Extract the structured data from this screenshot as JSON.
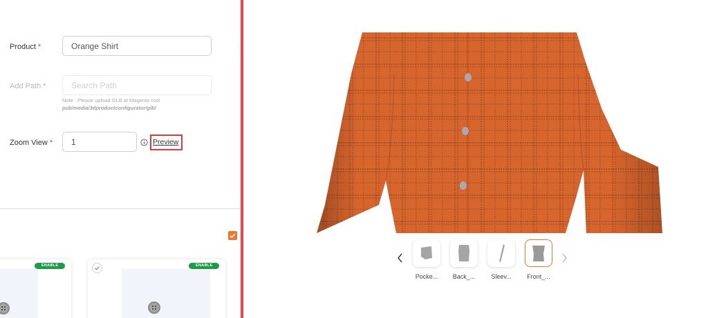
{
  "form": {
    "product": {
      "label": "Product",
      "required": "*",
      "value": "Orange Shirt"
    },
    "add_path": {
      "label": "Add Path",
      "required": "*",
      "placeholder": "Search Path"
    },
    "note_line1": "Note : Please upload GLB at Magento root",
    "note_line2": "pub/media/3dproductconfigurator/glb/",
    "zoom_view": {
      "label": "Zoom View",
      "required": "*",
      "value": "1"
    },
    "preview_label": "Preview"
  },
  "cards": [
    {
      "badge": "ENABLE"
    },
    {
      "badge": "ENABLE"
    }
  ],
  "thumbnails": [
    {
      "label": "Pocke...",
      "icon": "pocket-icon"
    },
    {
      "label": "Back_...",
      "icon": "back-icon"
    },
    {
      "label": "Sleev...",
      "icon": "sleeve-icon"
    },
    {
      "label": "Front_...",
      "icon": "front-icon",
      "active": true
    }
  ],
  "colors": {
    "accent_orange": "#f07630",
    "highlight_red": "#e5353b",
    "badge_green": "#1e9b46",
    "shirt_orange": "#d7652e"
  }
}
